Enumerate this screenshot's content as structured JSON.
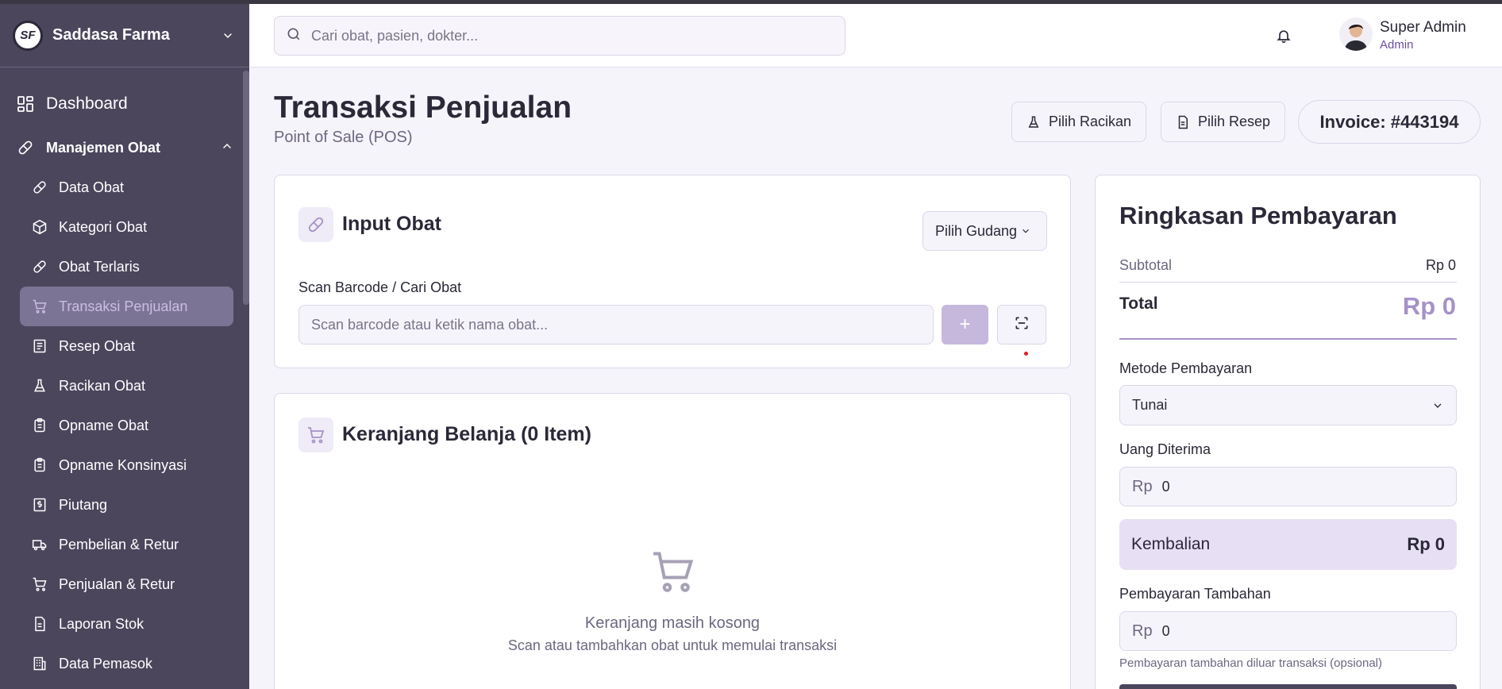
{
  "brand": {
    "name": "Saddasa Farma",
    "logo_text": "SF"
  },
  "sidebar": {
    "dashboard": "Dashboard",
    "group": "Manajemen Obat",
    "items": [
      {
        "label": "Data Obat",
        "icon": "pill-icon"
      },
      {
        "label": "Kategori Obat",
        "icon": "box-icon"
      },
      {
        "label": "Obat Terlaris",
        "icon": "pill-icon"
      },
      {
        "label": "Transaksi Penjualan",
        "icon": "cart-icon",
        "active": true
      },
      {
        "label": "Resep Obat",
        "icon": "receipt-icon"
      },
      {
        "label": "Racikan Obat",
        "icon": "flask-icon"
      },
      {
        "label": "Opname Obat",
        "icon": "clipboard-icon"
      },
      {
        "label": "Opname Konsinyasi",
        "icon": "clipboard-icon"
      },
      {
        "label": "Piutang",
        "icon": "dollar-receipt-icon"
      },
      {
        "label": "Pembelian & Retur",
        "icon": "truck-icon"
      },
      {
        "label": "Penjualan & Retur",
        "icon": "cart-icon"
      },
      {
        "label": "Laporan Stok",
        "icon": "file-icon"
      },
      {
        "label": "Data Pemasok",
        "icon": "building-icon"
      }
    ]
  },
  "header": {
    "search_placeholder": "Cari obat, pasien, dokter...",
    "user_name": "Super Admin",
    "user_role": "Admin"
  },
  "page": {
    "title": "Transaksi Penjualan",
    "subtitle": "Point of Sale (POS)",
    "btn_racikan": "Pilih Racikan",
    "btn_resep": "Pilih Resep",
    "invoice": "Invoice: #443194"
  },
  "input_obat": {
    "title": "Input Obat",
    "gudang": "Pilih Gudang",
    "field_label": "Scan Barcode / Cari Obat",
    "placeholder": "Scan barcode atau ketik nama obat...",
    "add_label": "+"
  },
  "cart": {
    "title": "Keranjang Belanja (0 Item)",
    "empty_title": "Keranjang masih kosong",
    "empty_sub": "Scan atau tambahkan obat untuk memulai transaksi"
  },
  "payment": {
    "title": "Ringkasan Pembayaran",
    "subtotal_label": "Subtotal",
    "subtotal_value": "Rp 0",
    "total_label": "Total",
    "total_value": "Rp 0",
    "method_label": "Metode Pembayaran",
    "method_value": "Tunai",
    "received_label": "Uang Diterima",
    "currency": "Rp",
    "received_value": "0",
    "change_label": "Kembalian",
    "change_value": "Rp 0",
    "extra_label": "Pembayaran Tambahan",
    "extra_value": "0",
    "extra_hint": "Pembayaran tambahan diluar transaksi (opsional)"
  },
  "colors": {
    "sidebar": "#4b465c",
    "accent": "#a592c6",
    "active_item": "#7c7494"
  }
}
